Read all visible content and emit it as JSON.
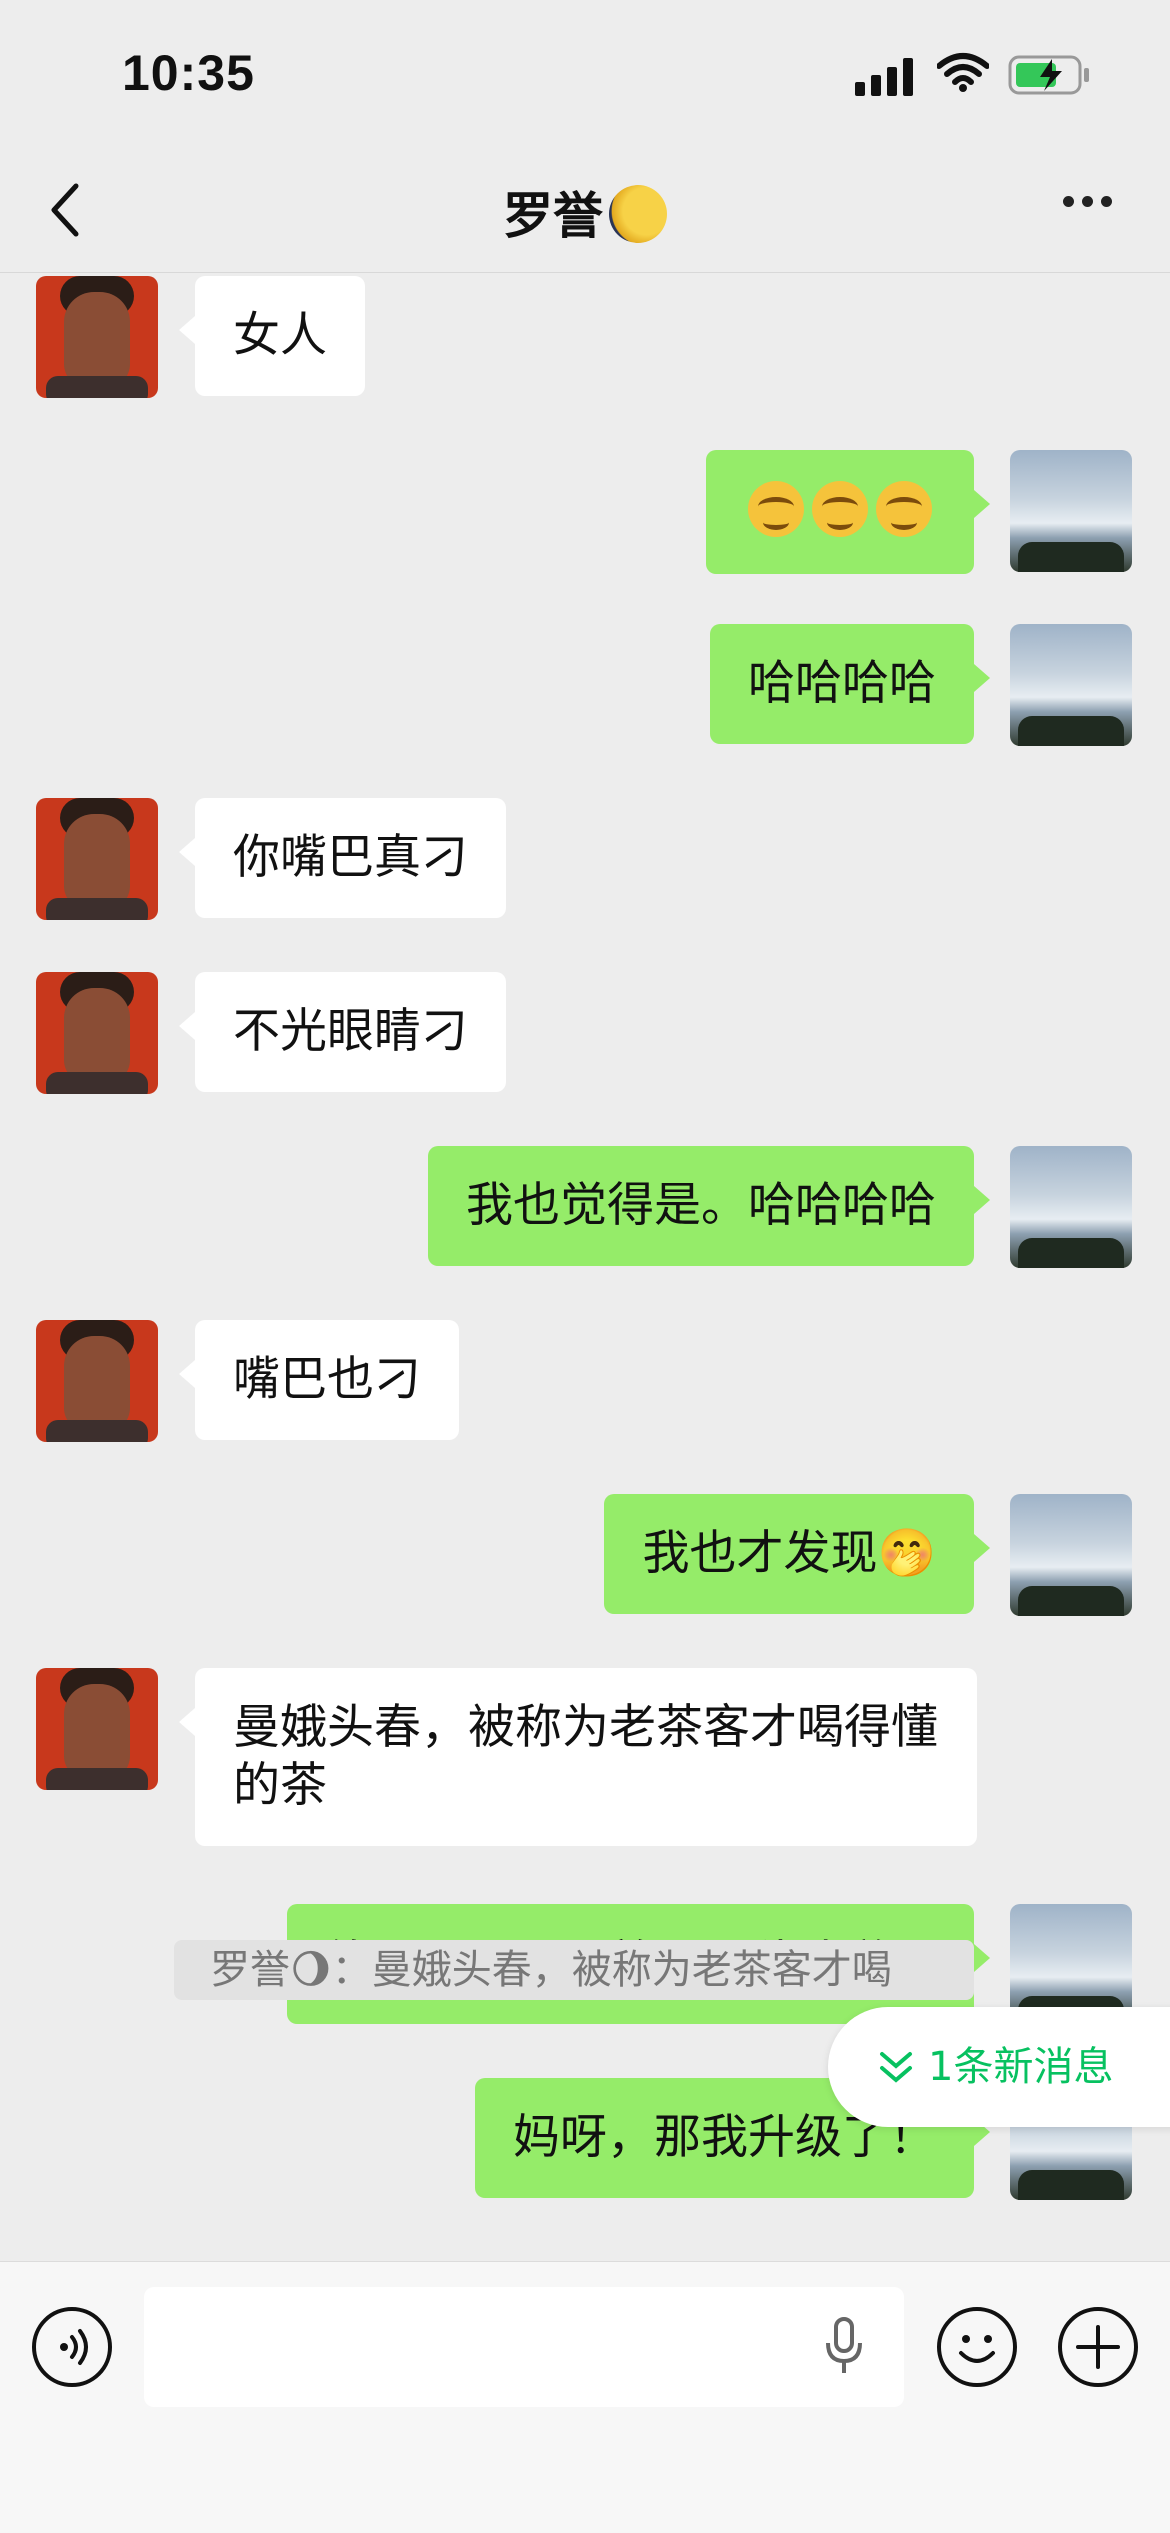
{
  "status_bar": {
    "time": "10:35"
  },
  "header": {
    "title": "罗誉"
  },
  "messages": [
    {
      "side": "in",
      "text": "女人"
    },
    {
      "side": "out",
      "text": "😏😏😏"
    },
    {
      "side": "out",
      "text": "哈哈哈哈"
    },
    {
      "side": "in",
      "text": "你嘴巴真刁"
    },
    {
      "side": "in",
      "text": "不光眼睛刁"
    },
    {
      "side": "out",
      "text": "我也觉得是。哈哈哈哈"
    },
    {
      "side": "in",
      "text": "嘴巴也刁"
    },
    {
      "side": "out",
      "text": "我也才发现🤭"
    },
    {
      "side": "in",
      "text": "曼娥头春，被称为老茶客才喝得懂的茶"
    },
    {
      "side": "out",
      "text": "终于不是只喝着是一种味道了"
    },
    {
      "side": "out",
      "text": "妈呀，那我升级了！"
    }
  ],
  "quote": {
    "text": "罗誉🌖：曼娥头春，被称为老茶客才喝"
  },
  "new_messages": {
    "label": "1条新消息"
  },
  "colors": {
    "outgoing_bubble": "#95ec69",
    "incoming_bubble": "#ffffff",
    "accent": "#07c160",
    "background": "#ededed"
  }
}
